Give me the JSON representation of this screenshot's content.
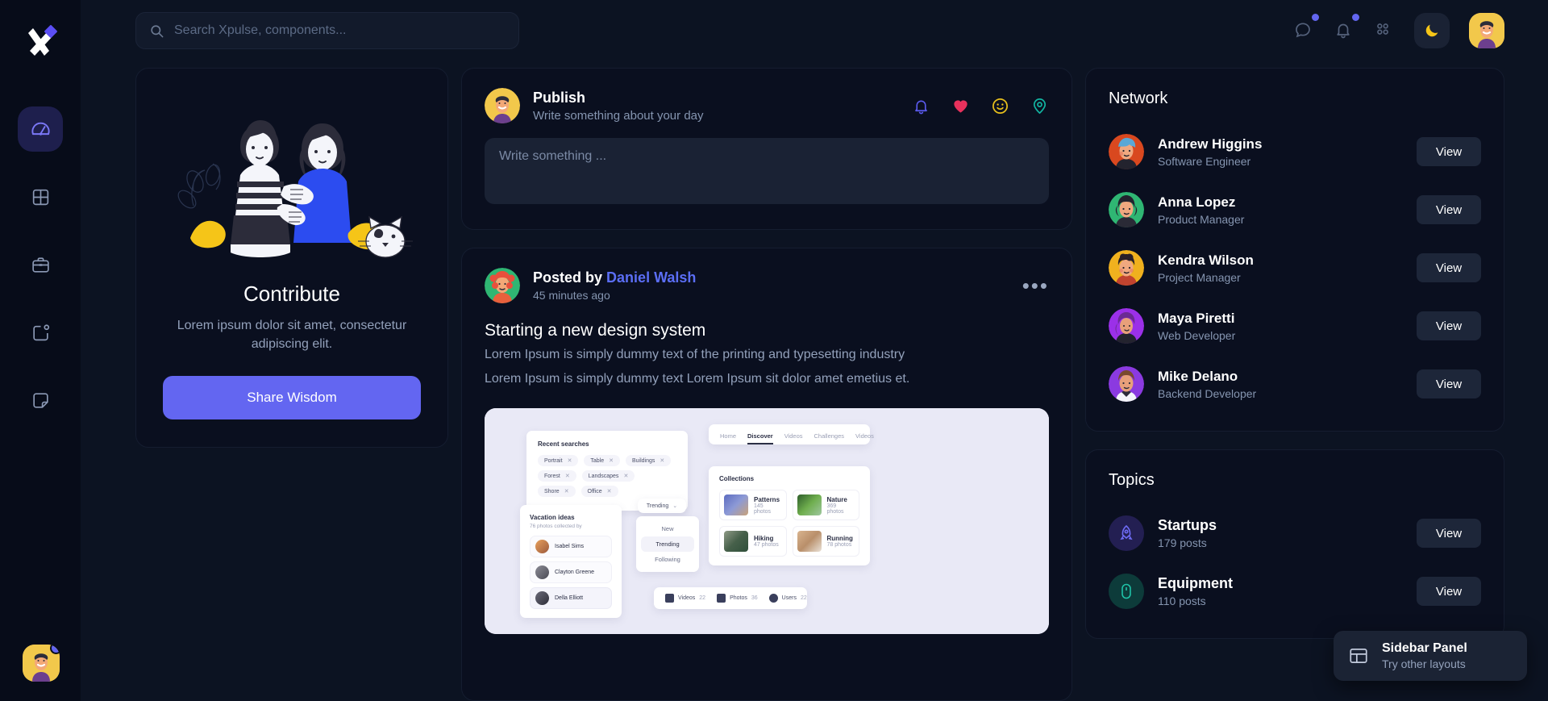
{
  "brand": {
    "logo_icon": "xpulse-logo-icon",
    "accent": "#6366f1"
  },
  "search": {
    "placeholder": "Search Xpulse, components...",
    "value": "",
    "icon": "search-icon"
  },
  "topbar": {
    "icons": [
      {
        "name": "messages-icon",
        "badge": true
      },
      {
        "name": "notifications-bell-icon",
        "badge": true
      },
      {
        "name": "apps-grid-icon",
        "badge": false
      }
    ],
    "theme_toggle": {
      "icon": "moon-icon",
      "label": "Dark mode"
    },
    "avatar": {
      "name": "user-avatar"
    }
  },
  "rail": {
    "items": [
      {
        "icon": "dashboard-speedometer-icon",
        "active": true
      },
      {
        "icon": "grid-squares-icon",
        "active": false
      },
      {
        "icon": "briefcase-icon",
        "active": false
      },
      {
        "icon": "notification-square-icon",
        "active": false
      },
      {
        "icon": "sticky-note-icon",
        "active": false
      }
    ],
    "avatar_status": "online"
  },
  "contribute": {
    "title": "Contribute",
    "description": "Lorem ipsum dolor sit amet, consectetur adipiscing elit.",
    "button_label": "Share Wisdom",
    "illustration": "couple-with-cat-illustration"
  },
  "publish": {
    "title": "Publish",
    "subtitle": "Write something about your day",
    "placeholder": "Write something ...",
    "value": "",
    "actions": [
      {
        "name": "reminder-bell-icon",
        "color": "#6366f1"
      },
      {
        "name": "heart-icon",
        "color": "#e8315c"
      },
      {
        "name": "emoji-smiley-icon",
        "color": "#e8c01c"
      },
      {
        "name": "location-pin-icon",
        "color": "#12b3a0"
      }
    ]
  },
  "post": {
    "posted_by_label": "Posted by",
    "author": "Daniel Walsh",
    "time": "45 minutes ago",
    "more_label": "•••",
    "title": "Starting a new design system",
    "body_line1": "Lorem Ipsum is simply dummy text of the printing and typesetting industry",
    "body_line2": "Lorem Ipsum is simply dummy text Lorem Ipsum sit dolor amet emetius et.",
    "media": {
      "recent_searches_title": "Recent searches",
      "recent_searches": [
        "Portrait",
        "Table",
        "Buildings",
        "Forest",
        "Landscapes",
        "Shore",
        "Office"
      ],
      "tabs": [
        "Home",
        "Discover",
        "Videos",
        "Challenges",
        "Videos"
      ],
      "active_tab": "Discover",
      "collections_title": "Collections",
      "collections": [
        {
          "name": "Patterns",
          "count": "145 photos"
        },
        {
          "name": "Nature",
          "count": "369 photos"
        },
        {
          "name": "Hiking",
          "count": "47 photos"
        },
        {
          "name": "Running",
          "count": "78 photos"
        }
      ],
      "vacation_title": "Vacation ideas",
      "vacation_sub": "76 photos collected by",
      "vacation_people": [
        "Isabel Sims",
        "Clayton Greene",
        "Della Elliott"
      ],
      "dropdown_value": "Trending",
      "dropdown_options": [
        "New",
        "Trending",
        "Following"
      ],
      "stats": [
        {
          "label": "Videos",
          "count": "22"
        },
        {
          "label": "Photos",
          "count": "36"
        },
        {
          "label": "Users",
          "count": "22"
        }
      ]
    }
  },
  "network": {
    "title": "Network",
    "view_label": "View",
    "people": [
      {
        "name": "Andrew Higgins",
        "role": "Software Engineer",
        "color": "#d9481f"
      },
      {
        "name": "Anna Lopez",
        "role": "Product Manager",
        "color": "#2fb673"
      },
      {
        "name": "Kendra Wilson",
        "role": "Project Manager",
        "color": "#f0b11e"
      },
      {
        "name": "Maya Piretti",
        "role": "Web Developer",
        "color": "#9b30e8"
      },
      {
        "name": "Mike Delano",
        "role": "Backend Developer",
        "color": "#8b3ae0"
      }
    ]
  },
  "topics": {
    "title": "Topics",
    "view_label": "View",
    "items": [
      {
        "name": "Startups",
        "posts": "179 posts",
        "icon": "rocket-icon",
        "bg": "#231f52",
        "fg": "#6f6cf5"
      },
      {
        "name": "Equipment",
        "posts": "110 posts",
        "icon": "mouse-icon",
        "bg": "#0d3b3a",
        "fg": "#1fc2a7"
      }
    ]
  },
  "tooltip": {
    "title": "Sidebar Panel",
    "subtitle": "Try other layouts",
    "icon": "layout-panel-icon"
  }
}
